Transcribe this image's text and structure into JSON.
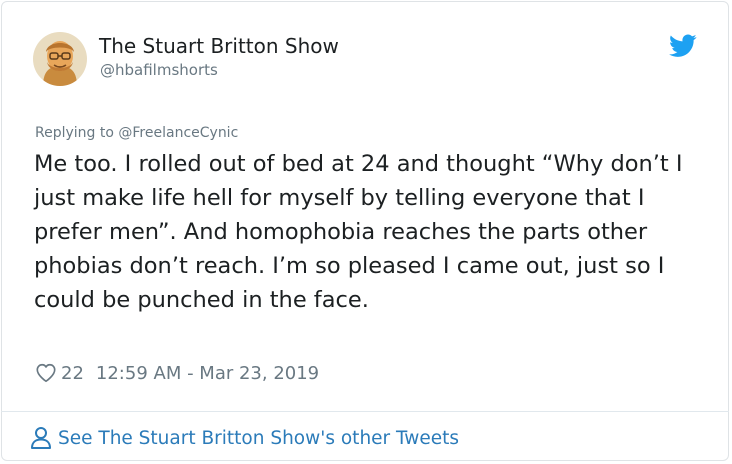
{
  "author": {
    "display_name": "The Stuart Britton Show",
    "handle": "@hbafilmshorts",
    "avatar_icon": "cartoon-face-avatar"
  },
  "brand": {
    "icon": "twitter-bird-icon",
    "color": "#1da1f2"
  },
  "reply": {
    "prefix": "Replying to ",
    "to_handle": "@FreelanceCynic"
  },
  "tweet": {
    "text": "Me too. I rolled out of bed at 24 and thought “Why don’t I just make life hell for myself by telling everyone that I prefer men”. And homophobia reaches the parts other phobias don’t reach. I’m so pleased I came out, just so I could be punched in the face."
  },
  "meta": {
    "like_icon": "heart-icon",
    "like_count": "22",
    "timestamp": "12:59 AM - Mar 23, 2019"
  },
  "footer": {
    "icon": "person-icon",
    "label": "See The Stuart Britton Show's other Tweets",
    "color": "#2b7bb9"
  }
}
